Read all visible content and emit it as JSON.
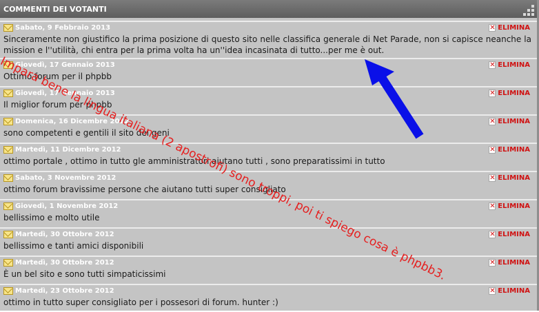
{
  "header": {
    "title": "COMMENTI DEI VOTANTI",
    "grip_icon": "resize-grip-icon"
  },
  "delete_label": "ELIMINA",
  "comments": [
    {
      "date": "Sabato, 9 Febbraio 2013",
      "text": "Sinceramente non giustifico la prima posizione di questo sito nelle classifica generale di Net Parade, non si capisce neanche la mission e l''utilità, chi entra per la prima volta ha un''idea incasinata di tutto...per me è out."
    },
    {
      "date": "Giovedì, 17 Gennaio 2013",
      "text": "Ottimo forum per il phpbb"
    },
    {
      "date": "Giovedì, 17 Gennaio 2013",
      "text": "Il miglior forum per phpbb"
    },
    {
      "date": "Domenica, 16 Dicembre 2012",
      "text": "sono competenti e gentili il sito dei geni"
    },
    {
      "date": "Martedì, 11 Dicembre 2012",
      "text": "ottimo portale , ottimo in tutto gle amministratori aiutano tutti , sono preparatissimi in tutto"
    },
    {
      "date": "Sabato, 3 Novembre 2012",
      "text": "ottimo forum bravissime persone che aiutano tutti super consigliato"
    },
    {
      "date": "Giovedì, 1 Novembre 2012",
      "text": "bellissimo e molto utile"
    },
    {
      "date": "Martedì, 30 Ottobre 2012",
      "text": "bellissimo e tanti amici disponibili"
    },
    {
      "date": "Martedì, 30 Ottobre 2012",
      "text": "È un bel sito e sono tutti simpaticissimi"
    },
    {
      "date": "Martedì, 23 Ottobre 2012",
      "text": "ottimo in tutto super consigliato per i possesori di forum. hunter :)"
    }
  ],
  "annotation": {
    "text": "Impara bene la lingua italiana (2 apostrofi) sono troppi, poi ti spiego cosa è phpbb3.",
    "color": "#e52020",
    "arrow_color": "#0a10e8"
  },
  "colors": {
    "header": "#666666",
    "panel": "#c4c4c4",
    "delete": "#d01212"
  }
}
